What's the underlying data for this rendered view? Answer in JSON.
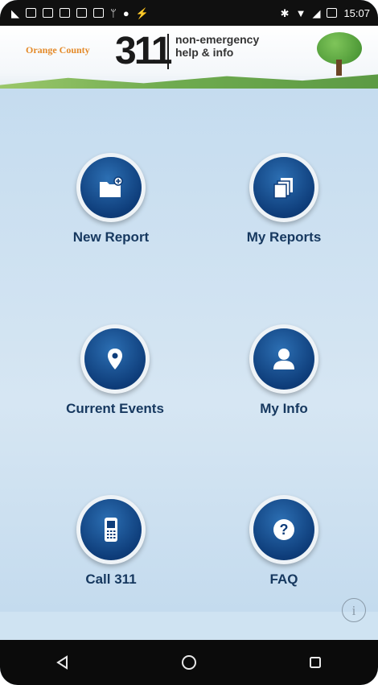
{
  "status_bar": {
    "time": "15:07",
    "left_icons": [
      "notification-icon",
      "sim-icon",
      "mail-icon",
      "mail-icon",
      "message-icon",
      "photo-icon",
      "usb-icon",
      "android-icon",
      "flash-icon"
    ],
    "right_icons": [
      "bluetooth-icon",
      "wifi-icon",
      "signal-icon",
      "battery-icon"
    ]
  },
  "header": {
    "county": "Orange County",
    "number": "311",
    "tagline_line1": "non-emergency",
    "tagline_line2": "help & info"
  },
  "tiles": [
    {
      "label": "New Report",
      "icon": "folder-add-icon"
    },
    {
      "label": "My Reports",
      "icon": "stacked-pages-icon"
    },
    {
      "label": "Current Events",
      "icon": "map-pin-icon"
    },
    {
      "label": "My Info",
      "icon": "person-icon"
    },
    {
      "label": "Call 311",
      "icon": "phone-icon"
    },
    {
      "label": "FAQ",
      "icon": "question-icon"
    }
  ],
  "info_glyph": "i",
  "colors": {
    "background": "#cfe3f2",
    "button": "#0e3d7a",
    "label": "#16385f",
    "county_text": "#e48a29"
  }
}
